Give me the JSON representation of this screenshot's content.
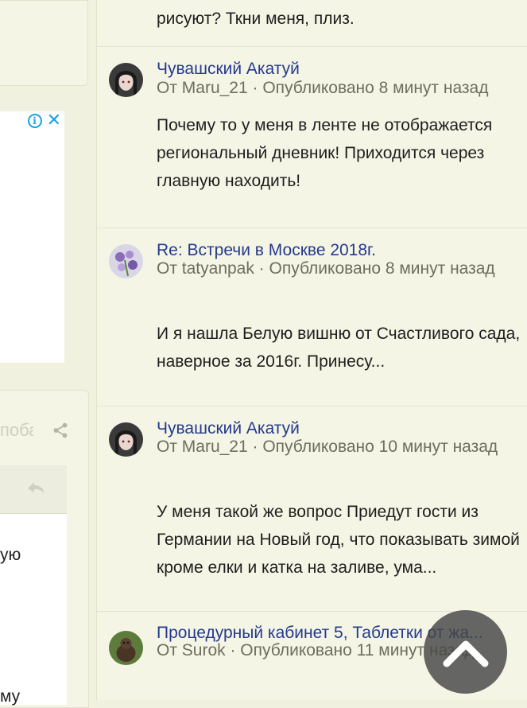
{
  "left": {
    "ad": {
      "info_glyph": "i",
      "close_glyph": "✕"
    },
    "faded_label": "поба",
    "text_fragment_1": "ую",
    "text_fragment_2": "му"
  },
  "feed": {
    "top_fragment": "рисуют? Ткни меня, плиз.",
    "items": [
      {
        "title": "Чувашский Акатуй",
        "meta": "От Maru_21 · Опубликовано 8 минут назад",
        "excerpt": "Почему то у меня в ленте не отображается региональный дневник! Приходится через главную находить!"
      },
      {
        "title": "Re: Встречи в Москве 2018г.",
        "meta": "От tatyanpak · Опубликовано 8 минут назад",
        "excerpt": "И я нашла Белую вишню от Счастливого сада, наверное за 2016г. Принесу..."
      },
      {
        "title": "Чувашский Акатуй",
        "meta": "От Maru_21 · Опубликовано 10 минут назад",
        "excerpt": "У меня такой же вопрос  Приедут гости из Германии на Новый год, что показывать зимой кроме елки и катка на заливе, ума..."
      },
      {
        "title": "Процедурный кабинет 5, Таблетки от жа...",
        "meta": "От Surok · Опубликовано 11 минут назад",
        "excerpt": ""
      }
    ]
  },
  "scroll_top": {
    "icon": "chevron-up-icon"
  },
  "colors": {
    "link": "#243a8c",
    "meta": "#6e6e5e",
    "background": "#f1f1df",
    "accent_blue": "#1aa1e6"
  }
}
